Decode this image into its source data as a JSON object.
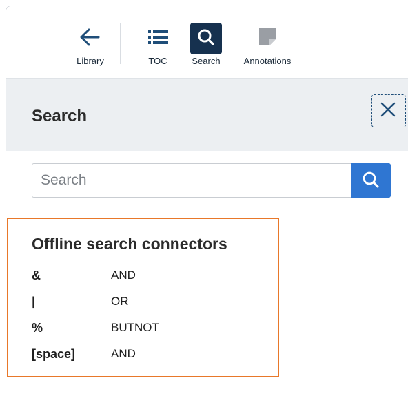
{
  "toolbar": {
    "items": [
      {
        "label": "Library",
        "icon": "arrow-left-icon"
      },
      {
        "label": "TOC",
        "icon": "list-icon"
      },
      {
        "label": "Search",
        "icon": "search-icon",
        "active": true
      },
      {
        "label": "Annotations",
        "icon": "note-icon"
      }
    ]
  },
  "search_panel": {
    "title": "Search",
    "close_icon": "close-icon",
    "input": {
      "placeholder": "Search",
      "value": ""
    },
    "submit_icon": "search-icon"
  },
  "connectors": {
    "title": "Offline search connectors",
    "rows": [
      {
        "symbol": "&",
        "operator": "AND"
      },
      {
        "symbol": "|",
        "operator": "OR"
      },
      {
        "symbol": "%",
        "operator": "BUTNOT"
      },
      {
        "symbol": "[space]",
        "operator": "AND"
      }
    ]
  },
  "colors": {
    "accent_blue": "#2f76d2",
    "active_tab_navy": "#16314f",
    "highlight_orange": "#e8782a",
    "header_gray": "#eceff2"
  }
}
